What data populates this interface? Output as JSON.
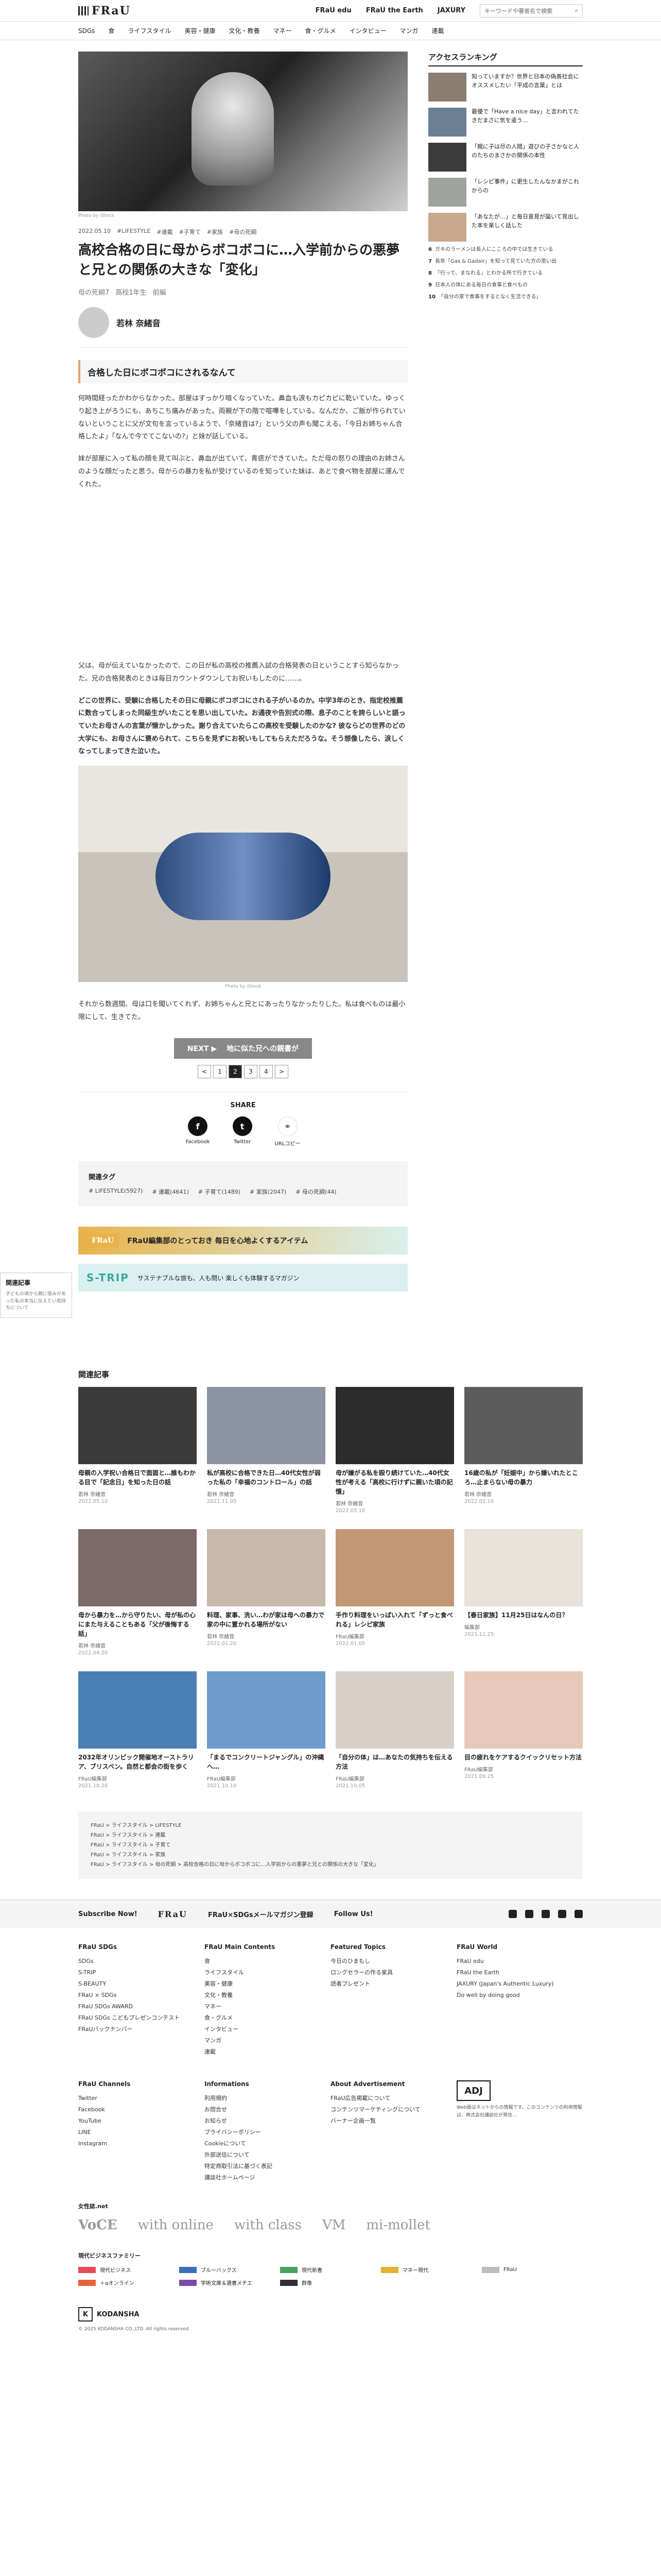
{
  "header": {
    "logo": "FRaU",
    "links": [
      "FRaU edu",
      "FRaU the Earth",
      "JAXURY"
    ],
    "search_placeholder": "キーワードや著者名で検索"
  },
  "nav": [
    "SDGs",
    "食",
    "ライフスタイル",
    "美容・健康",
    "文化・教養",
    "マネー",
    "食・グルメ",
    "インタビュー",
    "マンガ",
    "連載"
  ],
  "article": {
    "photo_credit": "Photo by iStock",
    "date": "2022.05.10",
    "categories": [
      "#LIFESTYLE",
      "#連載",
      "#子育て",
      "#家族",
      "#母の死綱"
    ],
    "title": "高校合格の日に母からボコボコに…入学前からの悪夢と兄との関係の大きな「変化」",
    "tags": [
      "母の死綱7",
      "高校1年生",
      "前編"
    ],
    "author": "若林 奈緒音",
    "heading": "合格した日にボコボコにされるなんて",
    "para1": "何時間経ったかわからなかった。部屋はすっかり暗くなっていた。鼻血も涙もカピカピに乾いていた。ゆっくり起き上がろうにも、あちこち痛みがあった。両親が下の階で喧嘩をしている。なんだか、ご飯が作られていないということに父が文句を言っているようで、「奈緒音は?」という父の声も聞こえる。「今日お姉ちゃん合格したよ」「なんで今でてこないの?」と妹が話している。",
    "para2": "妹が部屋に入って私の顔を見て叫ぶと、鼻血が出ていて、青痣ができていた。ただ母の怒りの理由のお姉さんのような顔だったと思う。母からの暴力を私が受けているのを知っていた妹は、あとで食べ物を部屋に運んでくれた。",
    "para3": "父は、母が伝えていなかったので、この日が私の高校の推薦入試の合格発表の日ということすら知らなかった。兄の合格発表のときは毎日カウントダウンしてお祝いもしたのに……。",
    "para4": "どこの世界に、受験に合格したその日に母親にボコボコにされる子がいるのか。中学3年のとき、指定校推薦に数合ってしまった同級生がいたことを思い出していた。お通夜や告別式の際、息子のことを誇らしいと語っていたお母さんの言葉が懐かしかった。謝り合えていたらこの高校を受験したのかな? 彼ならどの世界のどの大学にも、お母さんに褒められて、こちらを見ずにお祝いもしてもらえただろうな。そう想像したら、涙しくなってしまってきた泣いた。",
    "photo_credit2": "Photo by iStock",
    "para5": "それから数週間、母は口を聞いてくれず、お姉ちゃんと兄とにあったりなかったりした。私は食べものは最小限にして、生きてた。",
    "next_label": "NEXT ▶　 地に似た兄への親書が",
    "pages": [
      "<",
      "1",
      "2",
      "3",
      "4",
      ">"
    ],
    "share_title": "SHARE",
    "share": [
      {
        "icon": "facebook-icon",
        "glyph": "f",
        "label": "Facebook"
      },
      {
        "icon": "twitter-icon",
        "glyph": "t",
        "label": "Twitter"
      },
      {
        "icon": "link-icon",
        "glyph": "⚭",
        "label": "URLコピー"
      }
    ],
    "related_tags_title": "関連タグ",
    "related_tags": [
      "# LIFESTYLE(5927)",
      "# 連載(4641)",
      "# 子育て(1489)",
      "# 家族(2047)",
      "# 母の死綱(44)"
    ],
    "banner1_logo": "FRaU",
    "banner1_text": "FRaU編集部のとっておき 毎日を心地よくするアイテム",
    "banner2_logo": "S-TRIP",
    "banner2_text": "サステナブルな旅も、人も問い 楽しくも体験するマガジン"
  },
  "sidebar": {
    "title": "アクセスランキング",
    "ranks": [
      {
        "text": "知っていますか？世界と日本の偽善社会にオススメしたい「平成の言葉」とは"
      },
      {
        "text": "最優で「Have a nice day」と言われてたきだまさに気を遣う…"
      },
      {
        "text": "「親に子は尽の人間」遊びの子さかなと人のたちのまさかの関係の本性"
      },
      {
        "text": "「レシピ事件」に更生したんなかまがこれからの"
      },
      {
        "text": "「あなたが…」と毎日意見が届いて見出した本を楽しく話した"
      }
    ],
    "small_ranks": [
      {
        "n": "6",
        "t": "ガキのラーメンは長人にこころの中では生きている"
      },
      {
        "n": "7",
        "t": "長年「Gas & Gadair」を知って見ていた方の思い出"
      },
      {
        "n": "8",
        "t": "「行って、まなれる」とわかる所で行きている"
      },
      {
        "n": "9",
        "t": "日本人の体にある毎日の食事と食べもの"
      },
      {
        "n": "10",
        "t": "「自分の家で食事をするとなく生活できる」"
      }
    ]
  },
  "side_ad": {
    "label": "関連記事",
    "text": "子どもの頃から親に恨みがあった私の本当に伝えたい気持ちについて"
  },
  "related": {
    "title": "関連記事",
    "cards": [
      {
        "title": "母親の入学祝い合格日で面面と…誰もわかる目で「記念日」を知った日の話",
        "author": "若林 奈緒音",
        "date": "2022.05.10"
      },
      {
        "title": "私が高校に合格できた日…40代女性が弱った私の「幸福のコントロール」の話",
        "author": "若林 奈緒音",
        "date": "2021.11.05"
      },
      {
        "title": "母が嫌がる私を殴り続けていた…40代女性が考える「高校に行けずに親いた頃の記憶」",
        "author": "若林 奈緒音",
        "date": "2022.03.10"
      },
      {
        "title": "16歳の私が「妊娠中」から嫌いれたところ…止まらない母の暴力",
        "author": "若林 奈緒音",
        "date": "2022.02.10"
      },
      {
        "title": "母から暴力を…から守りたい、母が私の心にまた与えることもある「父が後悔する話」",
        "author": "若林 奈緒音",
        "date": "2022.04.20"
      },
      {
        "title": "料理、家事、洗い…わが家は母への暴力で家の中に置かれる場所がない",
        "author": "若林 奈緒音",
        "date": "2022.01.20"
      },
      {
        "title": "手作り料理をいっぱい入れて「ずっと食べれる」レシピ家族",
        "author": "FRaU編集部",
        "date": "2022.01.05"
      },
      {
        "title": "【春日家族】11月25日はなんの日？",
        "author": "編集部",
        "date": "2021.11.25"
      },
      {
        "title": "2032年オリンピック開催地オーストラリア、ブリスベン。自然と都会の街を歩く",
        "author": "FRaU編集部",
        "date": "2021.10.20"
      },
      {
        "title": "「まるでコンクリートジャングル」の沖縄へ…",
        "author": "FRaU編集部",
        "date": "2021.10.10"
      },
      {
        "title": "「自分の体」は…あなたの気持ちを伝える方法",
        "author": "FRaU編集部",
        "date": "2021.10.05"
      },
      {
        "title": "目の疲れをケアするクイックリセット方法",
        "author": "FRaU編集部",
        "date": "2021.09.25"
      }
    ]
  },
  "breadcrumb": [
    "FRaU > ライフスタイル > LIFESTYLE",
    "FRaU > ライフスタイル > 連載",
    "FRaU > ライフスタイル > 子育て",
    "FRaU > ライフスタイル > 家族",
    "FRaU > ライフスタイル > 母の死綱 > 高校合格の日に母からボコボコに…入学前からの悪夢と兄との関係の大きな「変化」"
  ],
  "footer": {
    "subscribe": "Subscribe Now!",
    "logo": "FRaU",
    "newsletter": "FRaU×SDGsメールマガジン登録",
    "follow": "Follow Us!",
    "cols": [
      {
        "title": "FRaU SDGs",
        "items": [
          "SDGs",
          "S-TRIP",
          "S-BEAUTY",
          "FRaU × SDGs",
          "FRaU SDGs AWARD",
          "FRaU SDGs こどもプレゼンコンテスト",
          "FRaUバックナンバー"
        ]
      },
      {
        "title": "FRaU Main Contents",
        "items": [
          "食",
          "ライフスタイル",
          "美容・健康",
          "文化・教養",
          "マネー",
          "食・グルメ",
          "インタビュー",
          "マンガ",
          "連載"
        ]
      },
      {
        "title": "Featured Topics",
        "items": [
          "今日のひまもし",
          "ロングセラーの作る家具",
          "読者プレゼント"
        ]
      },
      {
        "title": "FRaU World",
        "items": [
          "FRaU edu",
          "FRaU the Earth",
          "JAXURY (Japan's Authentic Luxury)",
          "Do well by doing good"
        ]
      },
      {
        "title": "FRaU Channels",
        "items": [
          "Twitter",
          "Facebook",
          "YouTube",
          "LINE",
          "Instagram"
        ]
      },
      {
        "title": "Informations",
        "items": [
          "利用規約",
          "お問合せ",
          "お知らせ",
          "プライバシーポリシー",
          "Cookieについて",
          "外部送信について",
          "特定商取引法に基づく表記",
          "講談社ホームページ"
        ]
      },
      {
        "title": "About Advertisement",
        "items": [
          "FRaU広告掲載について",
          "コンテンツマーケティングについて",
          "バーナー企画一覧"
        ]
      },
      {
        "title": "",
        "items": []
      }
    ],
    "adj_label": "ADJ",
    "adj_text": "Web版はネットからの情報です。このコンテンツの利用情報は、株式会社講談社が発信…",
    "group_title": "女性誌.net",
    "brands": [
      "VoCE",
      "with online",
      "with class",
      "VM",
      "mi-mollet"
    ],
    "biz_title": "現代ビジネスファミリー",
    "biz": [
      {
        "name": "現代ビジネス",
        "color": "#e64b5a"
      },
      {
        "name": "ブルーバックス",
        "color": "#3b6fb6"
      },
      {
        "name": "現代新書",
        "color": "#4aa05a"
      },
      {
        "name": "マネー現代",
        "color": "#e4b132"
      },
      {
        "name": "FRaU",
        "color": "#bdbdbd"
      },
      {
        "name": "＋αオンライン",
        "color": "#e8633a"
      },
      {
        "name": "学術文庫＆選書メチエ",
        "color": "#7c4aa8"
      },
      {
        "name": "群像",
        "color": "#2f2f2f"
      },
      {
        "name": "",
        "color": ""
      },
      {
        "name": "",
        "color": ""
      }
    ],
    "company": "KODANSHA",
    "copyright": "© 2025 KODANSHA CO.,LTD. All rights reserved."
  }
}
